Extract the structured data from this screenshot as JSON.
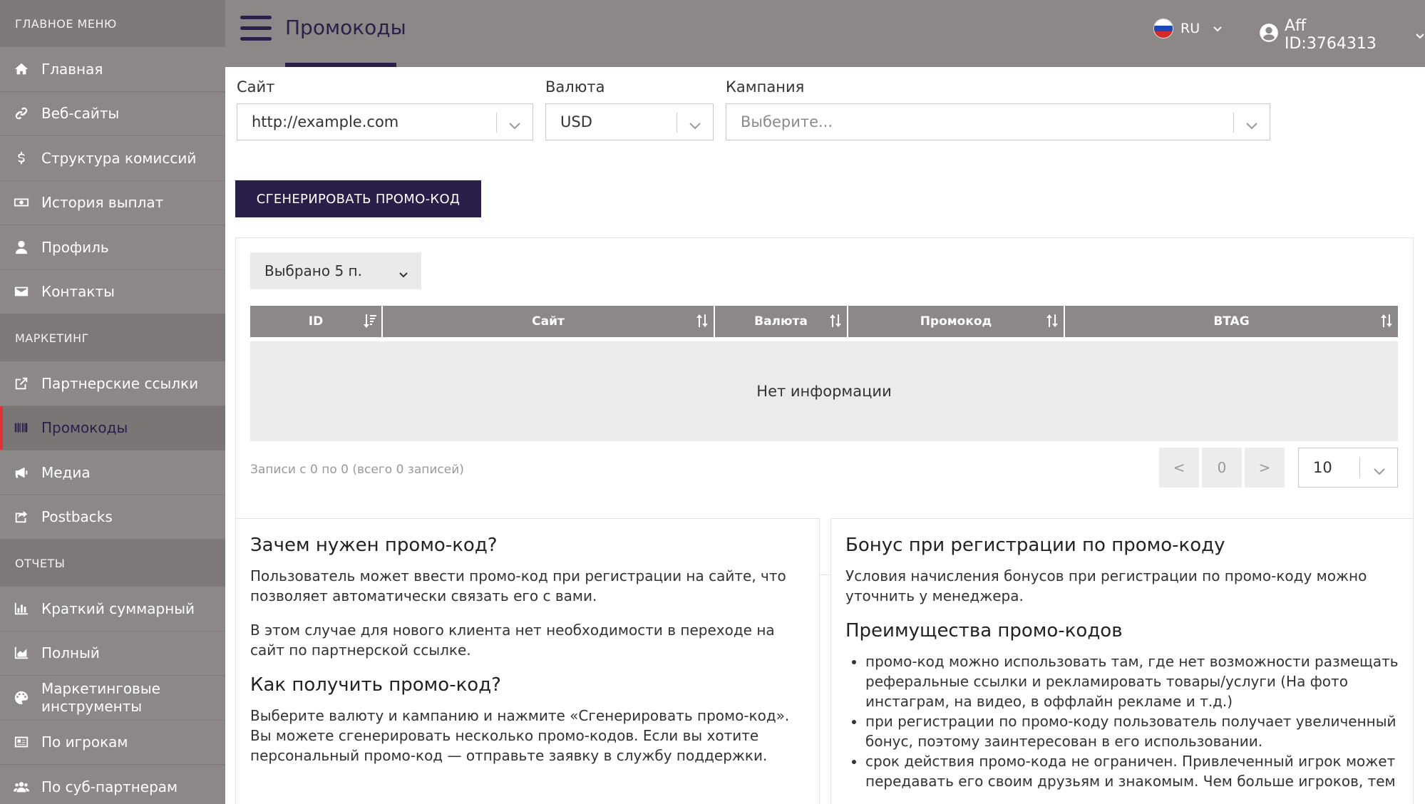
{
  "sidebar": {
    "section_main": "ГЛАВНОЕ МЕНЮ",
    "main_items": [
      {
        "label": "Главная",
        "icon": "home-icon"
      },
      {
        "label": "Веб-сайты",
        "icon": "link-icon"
      },
      {
        "label": "Структура комиссий",
        "icon": "dollar-icon"
      },
      {
        "label": "История выплат",
        "icon": "money-icon"
      },
      {
        "label": "Профиль",
        "icon": "user-icon"
      },
      {
        "label": "Контакты",
        "icon": "envelope-icon"
      }
    ],
    "section_marketing": "МАРКЕТИНГ",
    "marketing_items": [
      {
        "label": "Партнерские ссылки",
        "icon": "external-link-icon"
      },
      {
        "label": "Промокоды",
        "icon": "barcode-icon"
      },
      {
        "label": "Медиа",
        "icon": "megaphone-icon"
      },
      {
        "label": "Postbacks",
        "icon": "share-icon"
      }
    ],
    "section_reports": "ОТЧЕТЫ",
    "report_items": [
      {
        "label": "Краткий суммарный",
        "icon": "bar-chart-icon"
      },
      {
        "label": "Полный",
        "icon": "area-chart-icon"
      },
      {
        "label": "Маркетинговые инструменты",
        "icon": "palette-icon"
      },
      {
        "label": "По игрокам",
        "icon": "id-card-icon"
      },
      {
        "label": "По суб-партнерам",
        "icon": "users-icon"
      }
    ],
    "active": "Промокоды",
    "accent_color": "#e0303a"
  },
  "header": {
    "title": "Промокоды",
    "language": "RU",
    "affiliate": "Aff ID:3764313"
  },
  "filters": {
    "site_label": "Сайт",
    "site_value": "http://example.com",
    "currency_label": "Валюта",
    "currency_value": "USD",
    "campaign_label": "Кампания",
    "campaign_placeholder": "Выберите..."
  },
  "generate_button": "СГЕНЕРИРОВАТЬ ПРОМО-КОД",
  "table": {
    "column_selector": "Выбрано 5 п.",
    "columns": [
      "ID",
      "Сайт",
      "Валюта",
      "Промокод",
      "BTAG"
    ],
    "empty_text": "Нет информации",
    "records_text": "Записи с 0 по 0 (всего 0 записей)",
    "pager_prev": "<",
    "pager_page": "0",
    "pager_next": ">",
    "per_page": "10"
  },
  "info_left": {
    "heading1": "Зачем нужен промо-код?",
    "para1": "Пользователь может ввести промо-код при регистрации на сайте, что позволяет автоматически связать его с вами.",
    "para2": "В этом случае для нового клиента нет необходимости в переходе на сайт по партнерской ссылке.",
    "heading2": "Как получить промо-код?",
    "para3": "Выберите валюту и кампанию и нажмите «Сгенерировать промо-код». Вы можете сгенерировать несколько промо-кодов. Если вы хотите персональный промо-код — отправьте заявку в службу поддержки."
  },
  "info_right": {
    "heading1": "Бонус при регистрации по промо-коду",
    "para1": "Условия начисления бонусов при регистрации по промо-коду можно уточнить у менеджера.",
    "heading2": "Преимущества промо-кодов",
    "bullets": [
      "промо-код можно использовать там, где нет возможности размещать реферальные ссылки и рекламировать товары/услуги (На фото инстаграм, на видео, в оффлайн рекламе и т.д.)",
      "при регистрации по промо-коду пользователь получает увеличенный бонус, поэтому заинтересован в его использовании.",
      "срок действия промо-кода не ограничен. Привлеченный игрок может передавать его своим друзьям и знакомым. Чем больше игроков, тем"
    ]
  }
}
